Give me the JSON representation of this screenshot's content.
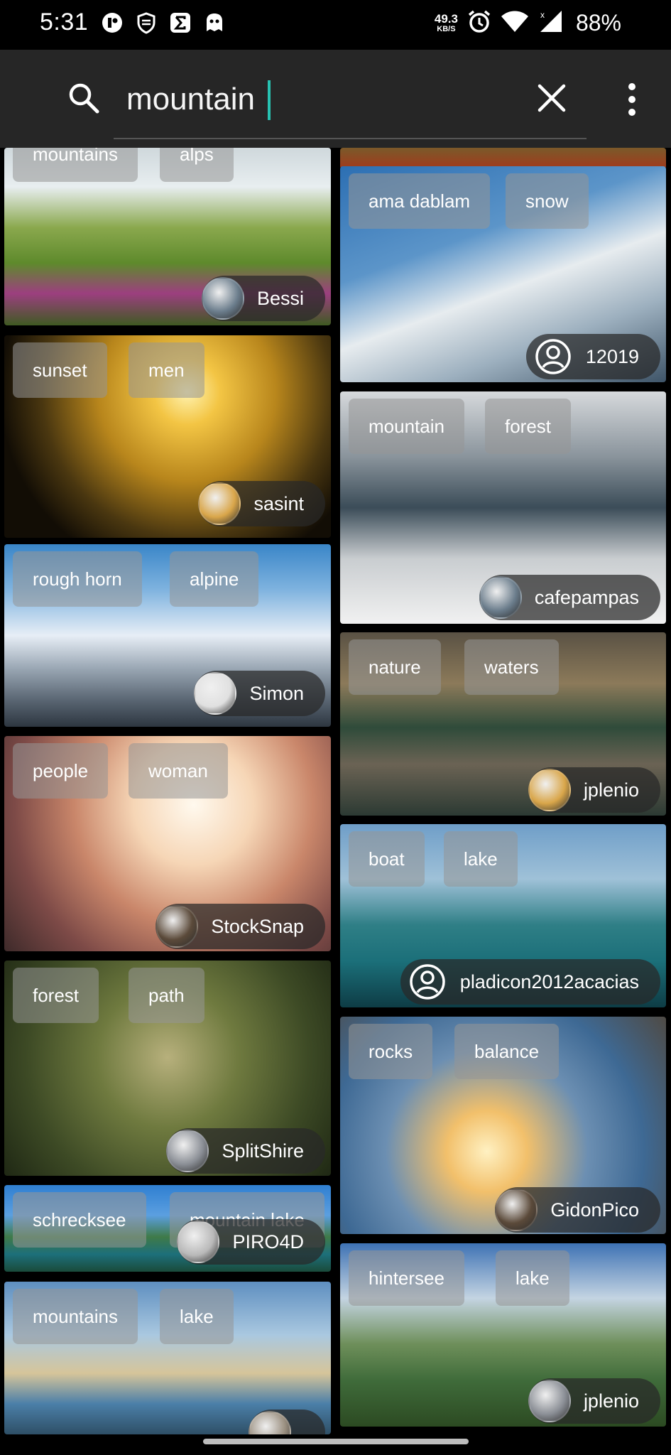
{
  "status_bar": {
    "time": "5:31",
    "speed_value": "49.3",
    "speed_unit": "KB/S",
    "battery": "88%",
    "icons": [
      "app-notification-icon",
      "shield-icon",
      "sigma-icon",
      "ghost-icon",
      "alarm-icon",
      "wifi-icon",
      "signal-icon"
    ]
  },
  "search": {
    "query": "mountain",
    "icons": [
      "search-icon",
      "close-icon",
      "more-vert-icon"
    ]
  },
  "left_column": [
    {
      "tags": [
        "mountains",
        "alps"
      ],
      "author": "Bessi",
      "avatar": true
    },
    {
      "tags": [
        "sunset",
        "men"
      ],
      "author": "sasint",
      "avatar": true
    },
    {
      "tags": [
        "rough horn",
        "alpine"
      ],
      "author": "Simon",
      "avatar": true
    },
    {
      "tags": [
        "people",
        "woman"
      ],
      "author": "StockSnap",
      "avatar": true
    },
    {
      "tags": [
        "forest",
        "path"
      ],
      "author": "SplitShire",
      "avatar": true
    },
    {
      "tags": [
        "schrecksee",
        "mountain lake"
      ],
      "author": "PIRO4D",
      "avatar": true
    },
    {
      "tags": [
        "mountains",
        "lake"
      ],
      "author": "",
      "avatar": true
    }
  ],
  "right_column": [
    {
      "tags": [
        "ama dablam",
        "snow"
      ],
      "author": "12019",
      "avatar": false
    },
    {
      "tags": [
        "mountain",
        "forest"
      ],
      "author": "cafepampas",
      "avatar": true
    },
    {
      "tags": [
        "nature",
        "waters"
      ],
      "author": "jplenio",
      "avatar": true
    },
    {
      "tags": [
        "boat",
        "lake"
      ],
      "author": "pladicon2012acacias",
      "avatar": false
    },
    {
      "tags": [
        "rocks",
        "balance"
      ],
      "author": "GidonPico",
      "avatar": true
    },
    {
      "tags": [
        "hintersee",
        "lake"
      ],
      "author": "jplenio",
      "avatar": true
    }
  ]
}
